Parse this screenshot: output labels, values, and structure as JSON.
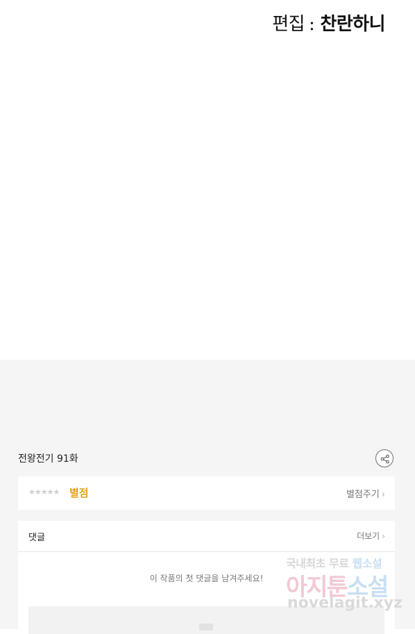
{
  "credit": {
    "role": "편집",
    "separator": ":",
    "name": "찬란하니"
  },
  "episode": {
    "title": "전왕전기 91화"
  },
  "rating": {
    "stars": "★★★★★",
    "label": "별점",
    "give": "별점주기"
  },
  "comments": {
    "title": "댓글",
    "more": "더보기",
    "empty": "이 작품의 첫 댓글을 남겨주세요!"
  },
  "watermark": {
    "line1a": "국내최초 무료",
    "line1b": "웹소설",
    "line2a": "아지툰",
    "line2b": "소설",
    "line3": "novelagit.xyz"
  },
  "chevron": "›",
  "colors": {
    "accent": "#e2a122",
    "background": "#f5f5f5"
  }
}
